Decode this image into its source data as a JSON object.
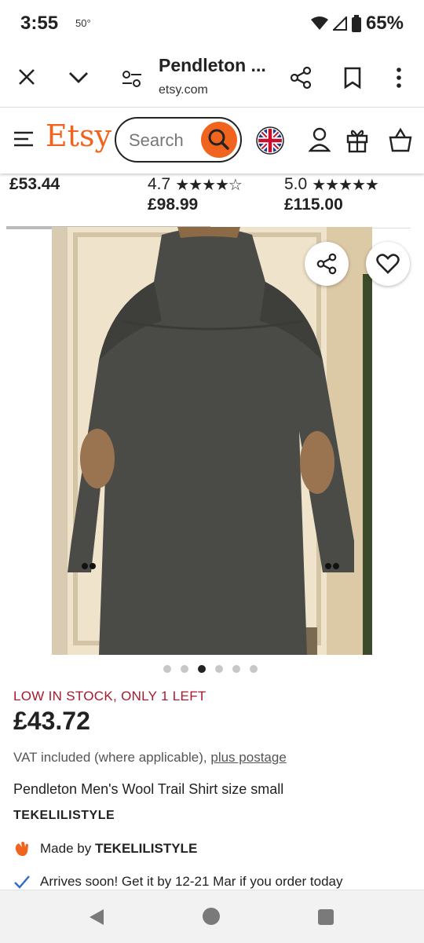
{
  "status_bar": {
    "time": "3:55",
    "temperature": "50°",
    "battery": "65%"
  },
  "custom_tab": {
    "title": "Pendleton ...",
    "url": "etsy.com"
  },
  "etsy_header": {
    "logo": "Etsy",
    "search_placeholder": "Search"
  },
  "recommendations": [
    {
      "rating": "",
      "price": "£53.44"
    },
    {
      "rating": "4.7",
      "price": "£98.99"
    },
    {
      "rating": "5.0",
      "price": "£115.00"
    }
  ],
  "gallery": {
    "image_count": 6,
    "active_index": 2
  },
  "product": {
    "stock_notice": "LOW IN STOCK, ONLY 1 LEFT",
    "price": "£43.72",
    "vat_text": "VAT included (where applicable),",
    "postage_link": "plus postage",
    "title": "Pendleton Men's Wool Trail Shirt size small",
    "shop_name": "TEKELILISTYLE",
    "made_by_prefix": "Made by",
    "made_by_shop": "TEKELILISTYLE",
    "arrival": "Arrives soon! Get it by 12-21 Mar if you order today"
  },
  "colors": {
    "etsy_orange": "#F1641E",
    "stock_red": "#A61A2E",
    "check_blue": "#2E6ACB"
  }
}
